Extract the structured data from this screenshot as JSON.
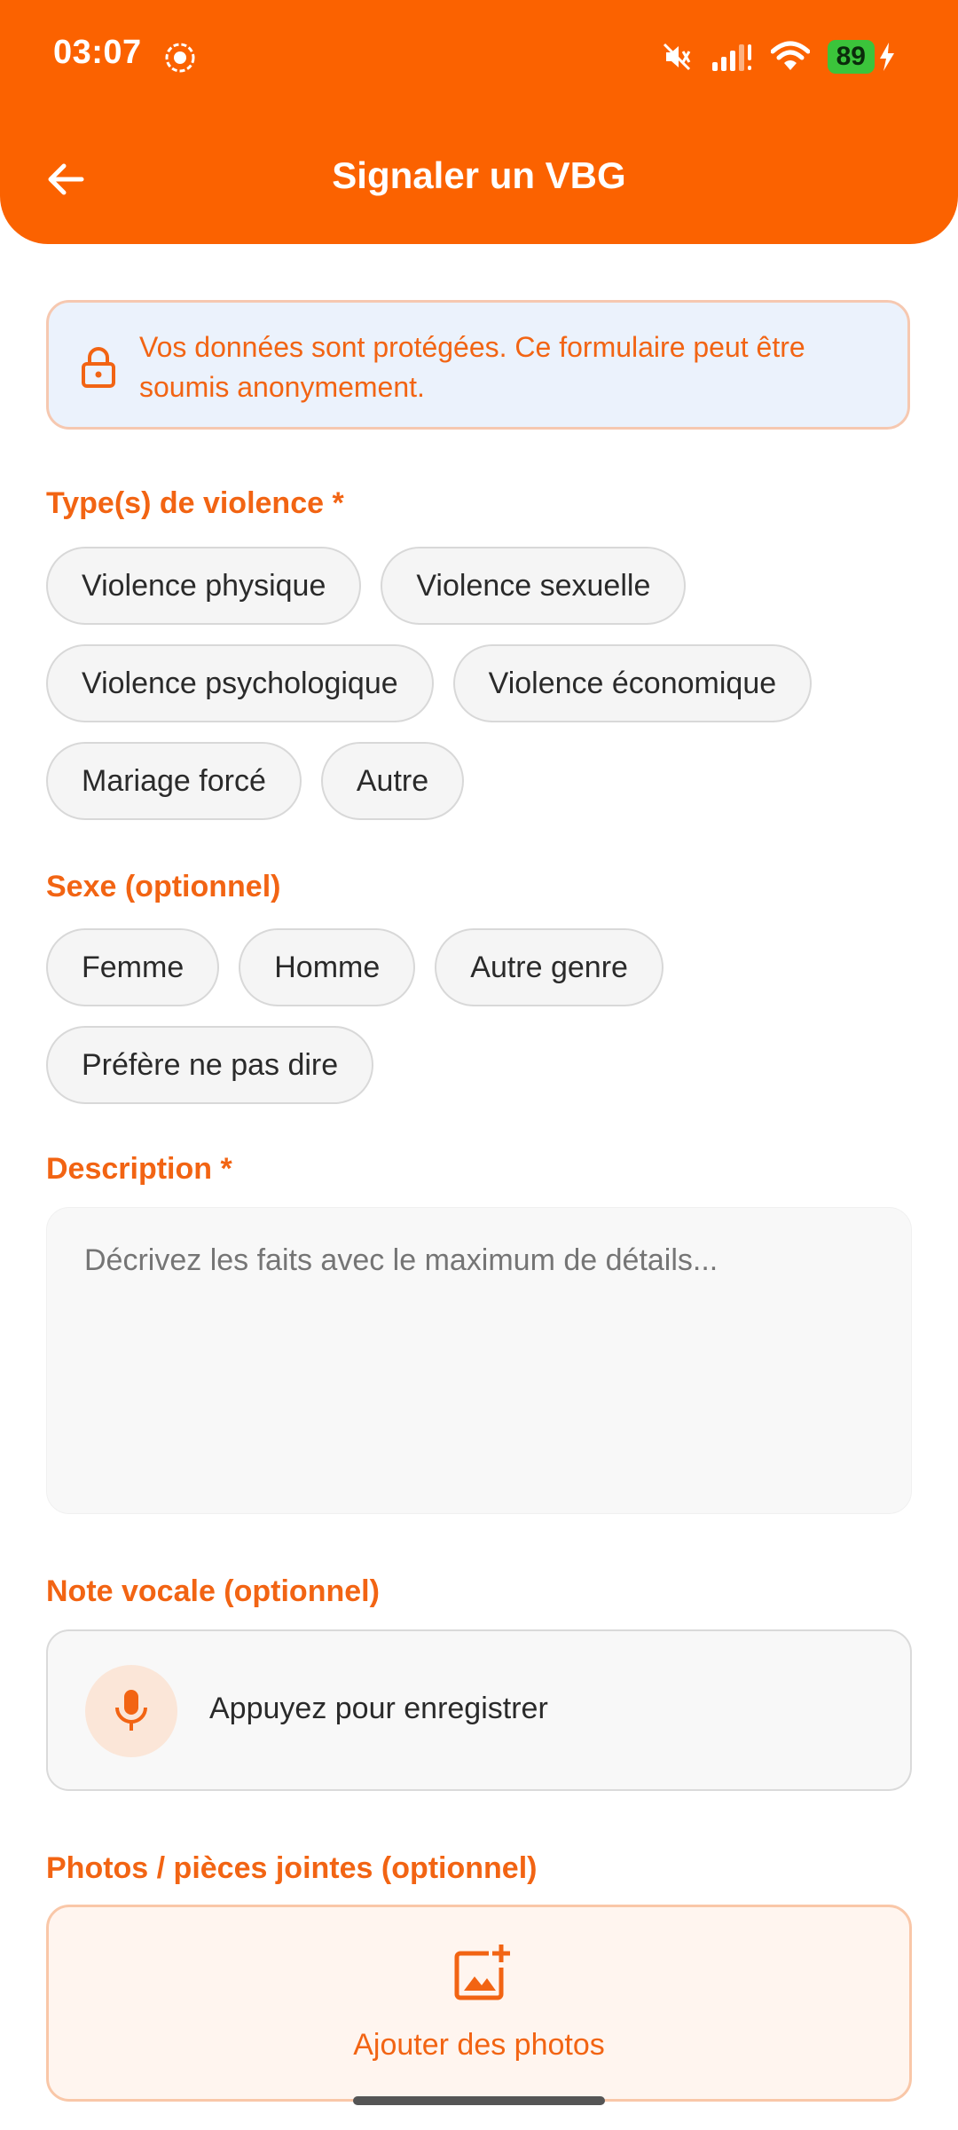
{
  "status_bar": {
    "time": "03:07",
    "battery": "89"
  },
  "header": {
    "title": "Signaler un VBG"
  },
  "notice": {
    "text": "Vos données sont protégées. Ce formulaire peut être soumis anonymement."
  },
  "violence": {
    "label": "Type(s) de violence *",
    "options": [
      "Violence physique",
      "Violence sexuelle",
      "Violence psychologique",
      "Violence économique",
      "Mariage forcé",
      "Autre"
    ]
  },
  "sexe": {
    "label": "Sexe (optionnel)",
    "options": [
      "Femme",
      "Homme",
      "Autre genre",
      "Préfère ne pas dire"
    ]
  },
  "description": {
    "label": "Description *",
    "placeholder": "Décrivez les faits avec le maximum de détails..."
  },
  "voice_note": {
    "label": "Note vocale (optionnel)",
    "action": "Appuyez pour enregistrer"
  },
  "attachments": {
    "label": "Photos / pièces jointes (optionnel)",
    "action": "Ajouter des photos"
  },
  "colors": {
    "brand": "#FB6200",
    "accent_text": "#F26413"
  }
}
